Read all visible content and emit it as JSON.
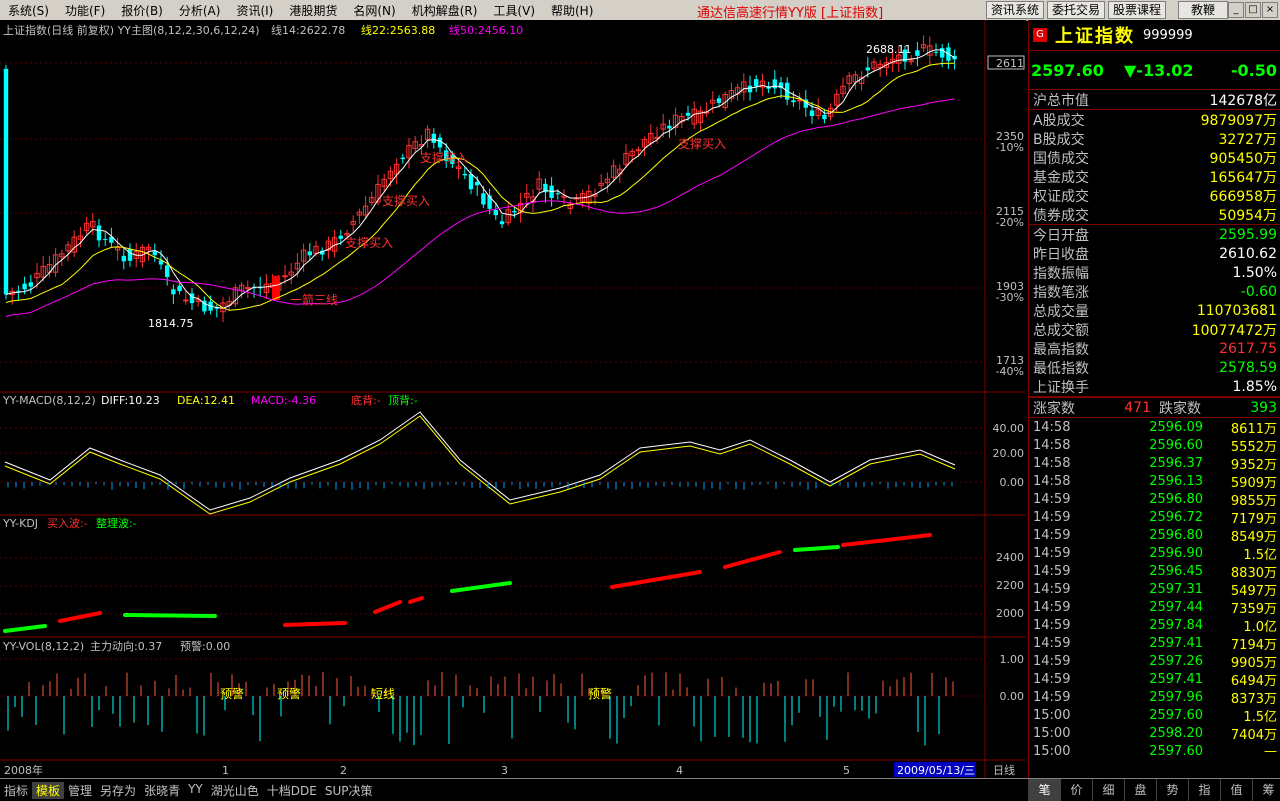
{
  "menu": [
    "系统(S)",
    "功能(F)",
    "报价(B)",
    "分析(A)",
    "资讯(I)",
    "港股期货",
    "名网(N)",
    "机构解盘(R)",
    "工具(V)",
    "帮助(H)"
  ],
  "app_title": "通达信高速行情YY版 [上证指数]",
  "top_buttons": [
    "资讯系统",
    "委托交易",
    "股票课程",
    "教鞭"
  ],
  "main_header": {
    "label": "上证指数(日线 前复权) YY主图(8,12,2,30,6,12,24)",
    "ma14": "线14:2622.78",
    "ma22": "线22:2563.88",
    "ma50": "线50:2456.10"
  },
  "price_axis": [
    {
      "v": "2611"
    },
    {
      "v": "2350",
      "p": "-10%"
    },
    {
      "v": "2115",
      "p": "-20%"
    },
    {
      "v": "1903",
      "p": "-30%"
    },
    {
      "v": "1713",
      "p": "-40%"
    }
  ],
  "annotations": {
    "high": "2688.11",
    "low": "1814.75",
    "sig1": "一箭三线",
    "sig2": "支撑买入",
    "sig3": "支撑买入",
    "sig4": "支撑买入",
    "sig5": "支撑买入"
  },
  "macd_header": {
    "label": "YY-MACD(8,12,2)",
    "diff": "DIFF:10.23",
    "dea": "DEA:12.41",
    "macd": "MACD:-4.36",
    "bottom": "底背:-",
    "top": "顶背:-"
  },
  "macd_axis": [
    "40.00",
    "20.00",
    "0.00"
  ],
  "kdj_header": {
    "label": "YY-KDJ",
    "buy": "买入波:-",
    "tidy": "整理波:-"
  },
  "kdj_axis": [
    "2400",
    "2200",
    "2000"
  ],
  "vol_header": {
    "label": "YY-VOL(8,12,2)",
    "main": "主力动向:0.37",
    "warn": "预警:0.00"
  },
  "vol_axis": [
    "1.00",
    "0.00"
  ],
  "vol_labels": [
    "预警",
    "预警",
    "短线",
    "预警"
  ],
  "time_axis": {
    "year": "2008年",
    "m1": "1",
    "m2": "2",
    "m3": "3",
    "m4": "4",
    "m5": "5",
    "date": "2009/05/13/三",
    "period": "日线"
  },
  "quote": {
    "name": "上证指数",
    "code": "999999",
    "price": "2597.60",
    "change": "▼-13.02",
    "pct": "-0.50",
    "rows": [
      {
        "k": "沪总市值",
        "v": "142678亿",
        "c": "#ffffff"
      },
      {
        "k": "A股成交",
        "v": "9879097万",
        "c": "#ffff00"
      },
      {
        "k": "B股成交",
        "v": "32727万",
        "c": "#ffff00"
      },
      {
        "k": "国债成交",
        "v": "905450万",
        "c": "#ffff00"
      },
      {
        "k": "基金成交",
        "v": "165647万",
        "c": "#ffff00"
      },
      {
        "k": "权证成交",
        "v": "666958万",
        "c": "#ffff00"
      },
      {
        "k": "债券成交",
        "v": "50954万",
        "c": "#ffff00"
      },
      {
        "k": "今日开盘",
        "v": "2595.99",
        "c": "#00ff00"
      },
      {
        "k": "昨日收盘",
        "v": "2610.62",
        "c": "#ffffff"
      },
      {
        "k": "指数振幅",
        "v": "1.50%",
        "c": "#ffffff"
      },
      {
        "k": "指数笔涨",
        "v": "-0.60",
        "c": "#00ff00"
      },
      {
        "k": "总成交量",
        "v": "110703681",
        "c": "#ffff00"
      },
      {
        "k": "总成交额",
        "v": "10077472万",
        "c": "#ffff00"
      },
      {
        "k": "最高指数",
        "v": "2617.75",
        "c": "#ff3030"
      },
      {
        "k": "最低指数",
        "v": "2578.59",
        "c": "#00ff00"
      },
      {
        "k": "上证换手",
        "v": "1.85%",
        "c": "#ffffff"
      }
    ],
    "up_label": "涨家数",
    "up": "471",
    "down_label": "跌家数",
    "down": "393"
  },
  "ticks": [
    {
      "t": "14:58",
      "p": "2596.09",
      "v": "8611万"
    },
    {
      "t": "14:58",
      "p": "2596.60",
      "v": "5552万"
    },
    {
      "t": "14:58",
      "p": "2596.37",
      "v": "9352万"
    },
    {
      "t": "14:58",
      "p": "2596.13",
      "v": "5909万"
    },
    {
      "t": "14:59",
      "p": "2596.80",
      "v": "9855万"
    },
    {
      "t": "14:59",
      "p": "2596.72",
      "v": "7179万"
    },
    {
      "t": "14:59",
      "p": "2596.80",
      "v": "8549万"
    },
    {
      "t": "14:59",
      "p": "2596.90",
      "v": "1.5亿"
    },
    {
      "t": "14:59",
      "p": "2596.45",
      "v": "8830万"
    },
    {
      "t": "14:59",
      "p": "2597.31",
      "v": "5497万"
    },
    {
      "t": "14:59",
      "p": "2597.44",
      "v": "7359万"
    },
    {
      "t": "14:59",
      "p": "2597.84",
      "v": "1.0亿"
    },
    {
      "t": "14:59",
      "p": "2597.41",
      "v": "7194万"
    },
    {
      "t": "14:59",
      "p": "2597.26",
      "v": "9905万"
    },
    {
      "t": "14:59",
      "p": "2597.41",
      "v": "6494万"
    },
    {
      "t": "14:59",
      "p": "2597.96",
      "v": "8373万"
    },
    {
      "t": "15:00",
      "p": "2597.60",
      "v": "1.5亿"
    },
    {
      "t": "15:00",
      "p": "2598.20",
      "v": "7404万"
    },
    {
      "t": "15:00",
      "p": "2597.60",
      "v": "—"
    }
  ],
  "bottom_tabs": [
    "指标",
    "模板",
    "管理",
    "另存为",
    "张晓青",
    "YY",
    "湖光山色",
    "十档DDE",
    "SUP决策"
  ],
  "right_tabs": [
    "笔",
    "价",
    "细",
    "盘",
    "势",
    "指",
    "值",
    "筹"
  ],
  "chart_data": {
    "type": "candlestick",
    "title": "上证指数(日线 前复权)",
    "high_label": 2688.11,
    "low_label": 1814.75,
    "last_close": 2597.6,
    "ylim": [
      1713,
      2700
    ]
  }
}
